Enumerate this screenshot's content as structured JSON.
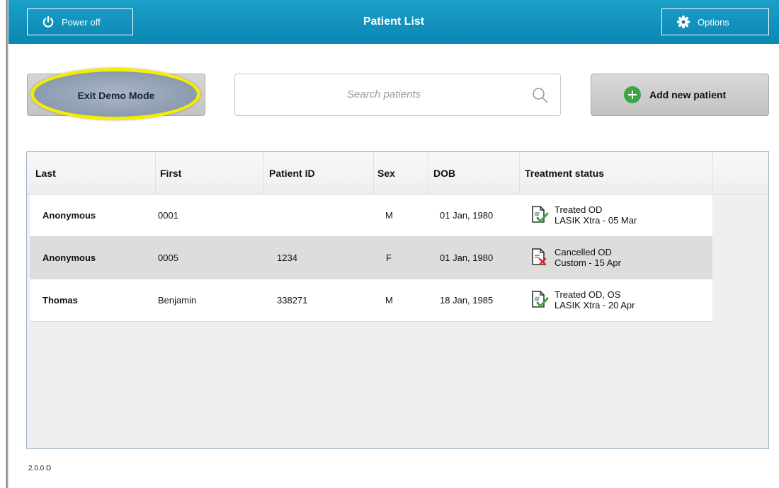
{
  "header": {
    "power_label": "Power off",
    "title": "Patient List",
    "options_label": "Options"
  },
  "toolbar": {
    "exit_demo_label": "Exit Demo Mode",
    "search_placeholder": "Search patients",
    "add_patient_label": "Add new patient"
  },
  "table": {
    "columns": [
      "Last",
      "First",
      "Patient ID",
      "Sex",
      "DOB",
      "Treatment status"
    ],
    "rows": [
      {
        "last": "Anonymous",
        "first": "0001",
        "patient_id": "",
        "sex": "M",
        "dob": "01 Jan, 1980",
        "status_line1": "Treated OD",
        "status_line2": "LASIK Xtra - 05 Mar",
        "status_icon": "document-check-icon"
      },
      {
        "last": "Anonymous",
        "first": "0005",
        "patient_id": "1234",
        "sex": "F",
        "dob": "01 Jan, 1980",
        "status_line1": "Cancelled OD",
        "status_line2": "Custom - 15 Apr",
        "status_icon": "document-cancel-icon"
      },
      {
        "last": "Thomas",
        "first": "Benjamin",
        "patient_id": "338271",
        "sex": "M",
        "dob": "18 Jan, 1985",
        "status_line1": "Treated OD, OS",
        "status_line2": "LASIK Xtra - 20 Apr",
        "status_icon": "document-check-icon"
      }
    ],
    "selected_row": 1
  },
  "footer": {
    "version": "2.0.0 D"
  },
  "colors": {
    "header": "#0b86b3",
    "highlight": "#f2ee00",
    "add_icon": "#3aa543",
    "check": "#3aa543",
    "cancel": "#d02a2a"
  }
}
